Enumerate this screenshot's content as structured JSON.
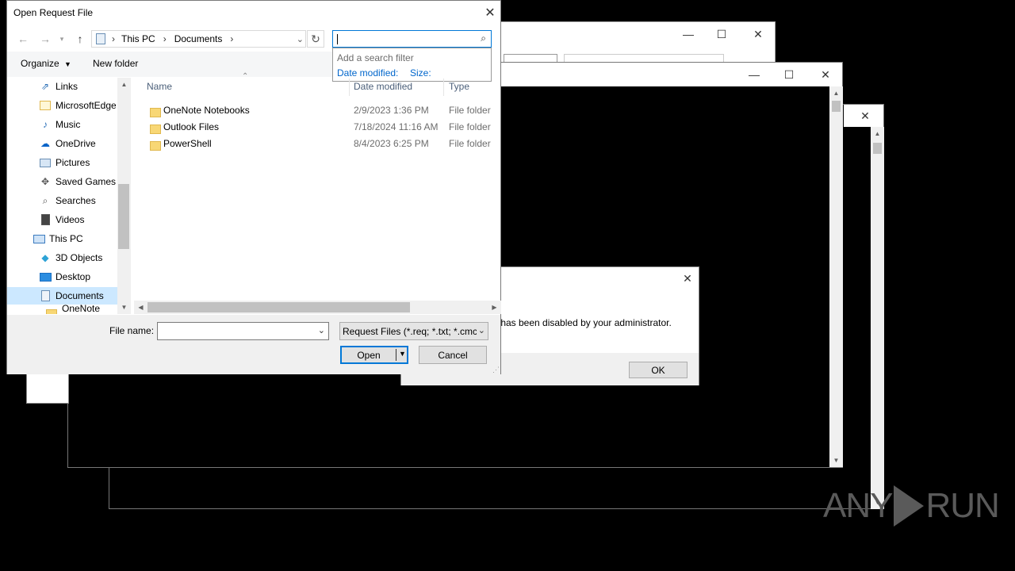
{
  "dialog": {
    "title": "Open Request File",
    "close_glyph": "✕"
  },
  "address_bar": {
    "segments": [
      "This PC",
      "Documents"
    ],
    "separator": "›"
  },
  "search": {
    "value": "",
    "dropdown_title": "Add a search filter",
    "filters": [
      "Date modified:",
      "Size:"
    ]
  },
  "toolbar": {
    "organize_label": "Organize",
    "new_folder_label": "New folder"
  },
  "tree": {
    "items": [
      {
        "label": "Links",
        "icon": "links-icon"
      },
      {
        "label": "MicrosoftEdge",
        "icon": "folder-icon"
      },
      {
        "label": "Music",
        "icon": "music-icon"
      },
      {
        "label": "OneDrive",
        "icon": "onedrive-icon"
      },
      {
        "label": "Pictures",
        "icon": "pictures-icon"
      },
      {
        "label": "Saved Games",
        "icon": "saved-games-icon"
      },
      {
        "label": "Searches",
        "icon": "searches-icon"
      },
      {
        "label": "Videos",
        "icon": "videos-icon"
      },
      {
        "label": "This PC",
        "icon": "this-pc-icon"
      },
      {
        "label": "3D Objects",
        "icon": "3d-objects-icon"
      },
      {
        "label": "Desktop",
        "icon": "desktop-icon"
      },
      {
        "label": "Documents",
        "icon": "documents-icon"
      },
      {
        "label": "OneNote Not",
        "icon": "folder-icon"
      }
    ]
  },
  "columns": {
    "name": "Name",
    "date_modified": "Date modified",
    "type": "Type"
  },
  "files": [
    {
      "name": "OneNote Notebooks",
      "date": "2/9/2023 1:36 PM",
      "type": "File folder"
    },
    {
      "name": "Outlook Files",
      "date": "7/18/2024 11:16 AM",
      "type": "File folder"
    },
    {
      "name": "PowerShell",
      "date": "8/4/2023 6:25 PM",
      "type": "File folder"
    }
  ],
  "footer": {
    "file_name_label": "File name:",
    "file_name_value": "",
    "file_type_selected": "Request Files (*.req; *.txt; *.cmc",
    "open_label": "Open",
    "cancel_label": "Cancel"
  },
  "alert": {
    "message": "r has been disabled by your administrator.",
    "ok_label": "OK"
  },
  "watermark": {
    "text_left": "ANY",
    "text_right": "RUN"
  },
  "colors": {
    "accent": "#0078d7",
    "selected_bg": "#cce8ff",
    "button_bg": "#e1e1e1"
  }
}
